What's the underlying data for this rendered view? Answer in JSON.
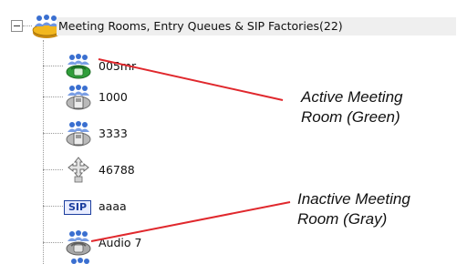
{
  "tree": {
    "root": {
      "label": "Meeting Rooms, Entry Queues & SIP Factories(22)",
      "expanded": true,
      "expander_symbol": "minus"
    },
    "items": [
      {
        "label": "005mr",
        "icon": "meeting-room-active-icon",
        "state": "active",
        "color": "#2f9e3a"
      },
      {
        "label": "1000",
        "icon": "entry-queue-icon",
        "color": "#8a8a8a"
      },
      {
        "label": "3333",
        "icon": "entry-queue-icon",
        "color": "#8a8a8a"
      },
      {
        "label": "46788",
        "icon": "gateway-profile-icon",
        "color": "#8a8a8a"
      },
      {
        "label": "aaaa",
        "icon": "sip-factory-icon",
        "badge": "SIP",
        "color": "#1c3e9e"
      },
      {
        "label": "Audio 7",
        "icon": "meeting-room-inactive-icon",
        "state": "inactive",
        "color": "#8a8a8a"
      }
    ]
  },
  "callouts": {
    "active": {
      "line1": "Active Meeting",
      "line2": "Room (Green)"
    },
    "inactive": {
      "line1": "Inactive Meeting",
      "line2": "Room (Gray)"
    },
    "pointer_color": "#e0282d"
  }
}
